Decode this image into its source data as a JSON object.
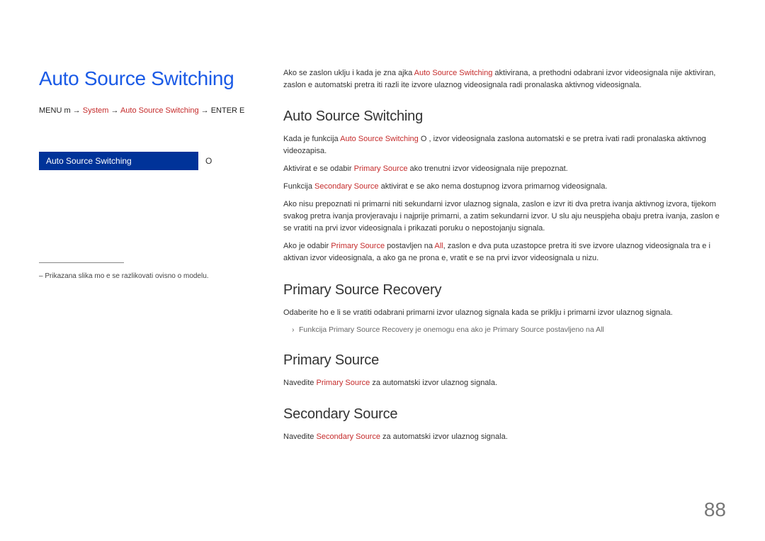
{
  "left": {
    "title": "Auto Source Switching",
    "menu_path": {
      "p1": "MENU m → ",
      "system": "System",
      "arrow1": " → ",
      "item": "Auto Source Switching",
      "p2": " → ENTER E"
    },
    "menu_box": {
      "label": "Auto Source Switching",
      "value": "O"
    },
    "footnote": "Prikazana slika mo e se razlikovati ovisno o modelu."
  },
  "right": {
    "intro": {
      "t1": "Ako se zaslon uklju i kada je zna ajka ",
      "r1": "Auto Source Switching",
      "t2": " aktivirana, a prethodni odabrani izvor videosignala nije aktiviran, zaslon  e automatski pretra iti razli ite izvore ulaznog videosignala radi pronalaska aktivnog videosignala."
    },
    "s1_title": "Auto Source Switching",
    "s1_p1": {
      "t1": "Kada je funkcija ",
      "r1": "Auto Source Switching",
      "t2": " O , izvor videosignala zaslona automatski  e se pretra ivati radi pronalaska aktivnog videozapisa."
    },
    "s1_p2": {
      "t1": "Aktivirat  e se odabir ",
      "r1": "Primary Source",
      "t2": " ako trenutni izvor videosignala nije prepoznat."
    },
    "s1_p3": {
      "t1": "Funkcija ",
      "r1": "Secondary Source",
      "t2": " aktivirat  e se ako nema dostupnog izvora primarnog videosignala."
    },
    "s1_p4": "Ako nisu prepoznati ni primarni niti sekundarni izvor ulaznog signala, zaslon  e izvr iti dva pretra ivanja aktivnog izvora, tijekom svakog pretra ivanja provjeravaju i najprije primarni, a zatim sekundarni izvor. U slu aju neuspjeha obaju pretra ivanja, zaslon  e se vratiti na prvi izvor videosignala i prikazati poruku o nepostojanju signala.",
    "s1_p5": {
      "t1": "Ako je odabir ",
      "r1": "Primary Source",
      "t2": " postavljen na ",
      "r2": "All",
      "t3": ", zaslon  e dva puta uzastopce pretra iti sve izvore ulaznog videosignala tra e i aktivan izvor videosignala, a ako ga ne prona e, vratit  e se na prvi izvor videosignala u nizu."
    },
    "s2_title": "Primary Source Recovery",
    "s2_p1": "Odaberite ho e li se vratiti odabrani primarni izvor ulaznog signala kada se priklju i primarni izvor ulaznog signala.",
    "s2_note": {
      "t1": "Funkcija ",
      "r1": "Primary Source Recovery",
      "t2": " je onemogu ena ako je ",
      "r2": "Primary Source",
      "t3": " postavljeno na ",
      "r3": "All"
    },
    "s3_title": "Primary Source",
    "s3_p1": {
      "t1": "Navedite ",
      "r1": "Primary Source",
      "t2": " za automatski izvor ulaznog signala."
    },
    "s4_title": "Secondary Source",
    "s4_p1": {
      "t1": "Navedite ",
      "r1": "Secondary Source",
      "t2": " za automatski izvor ulaznog signala."
    }
  },
  "page_number": "88"
}
